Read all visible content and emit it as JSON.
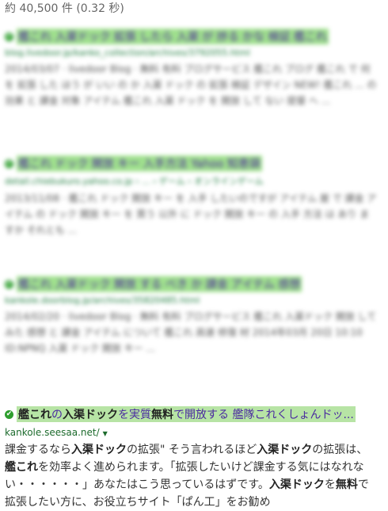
{
  "stats": "約 40,500 件 (0.32 秒)",
  "blurred_results": [
    {
      "title": "艦これ 入渠ドック 拡張 したら 入渠 が 捗る かな 検証 艦これ",
      "url": "blog.livedoor.jp/kanko_collection/archives/3792055.html",
      "snippet": "2014/03/07 · livedoor Blog · 無料 有料 ブログサービス 艦これ ブログ 艦これ で 何 を 拡張 した ほう が いい の か 入渠 ドック の 拡張 検証 デザイン NEW! 艦これ ... の 効果 と 課金 対象 アイテム 艦これ 入渠 ドック を 開放 して ない 提督 へ ..."
    },
    {
      "title": "艦これ ドック 開放 キー 入手方法 Yahoo 知恵袋",
      "url": "detail.chiebukuro.yahoo.co.jp › ... › ゲーム › オンラインゲーム",
      "snippet": "2013/11/08 · 艦これ ドック 開放 キー を 入手 したいのですが アイテム 屋 で 課金 アイテム の ドック 開放 キー を 買う 以外 に ドック 開放 キー の 入手 方法 は あり ますか それとも ..."
    },
    {
      "title": "艦これ 入渠ドック 開放 する べき か 課金 アイテム 感想",
      "url": "kankole.doorblog.jp/archives/35820485.html",
      "snippet": "2014/02/20 · livedoor Blog · 無料 有料 ブログサービス 艦これ 入渠ドック 開放 して みた 感想 と 課金 アイテム について 艦これ 高速 修復 材 2014年03月 20日 10:10 ID:NPNQ 入渠 ドック 開放 キー ..."
    }
  ],
  "result": {
    "title_b1": "艦これ",
    "title_t1": "の",
    "title_b2": "入渠ドック",
    "title_t2": "を実質",
    "title_b3": "無料",
    "title_t3": "で開放する 艦隊これくしょんドッ...",
    "url": "kankole.seesaa.net/",
    "snippet": {
      "p1": "課金するなら",
      "b1": "入渠ドック",
      "p2": "の拡張\" そう言われるほど",
      "b2": "入渠ドック",
      "p3": "の拡張は、",
      "b3": "艦これ",
      "p4": "を効率よく進められます。「拡張したいけど課金する気にはなれない・・・・・・」あなたはこう思っているはずです。",
      "b4": "入渠ドック",
      "p5": "を",
      "b5": "無料",
      "p6": "で拡張したい方に、お役立ちサイト「ぱん工」をお勧め"
    }
  }
}
